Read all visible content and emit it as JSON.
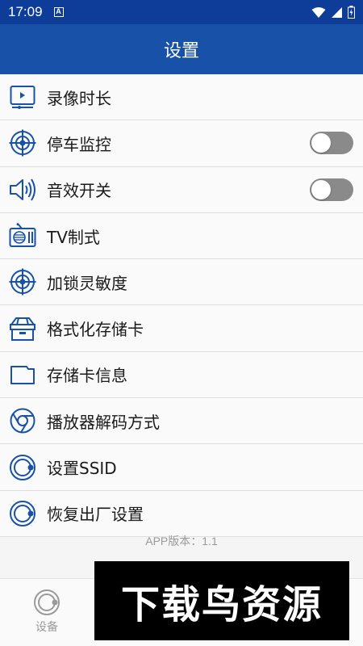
{
  "status_bar": {
    "time": "17:09",
    "a_badge": "A"
  },
  "app_bar": {
    "title": "设置"
  },
  "settings": [
    {
      "label": "录像时长",
      "icon": "video-duration-icon",
      "toggle": null
    },
    {
      "label": "停车监控",
      "icon": "target-icon",
      "toggle": false
    },
    {
      "label": "音效开关",
      "icon": "speaker-icon",
      "toggle": false
    },
    {
      "label": "TV制式",
      "icon": "tv-icon",
      "toggle": null
    },
    {
      "label": "加锁灵敏度",
      "icon": "target-icon",
      "toggle": null
    },
    {
      "label": "格式化存储卡",
      "icon": "box-icon",
      "toggle": null
    },
    {
      "label": "存储卡信息",
      "icon": "sd-card-icon",
      "toggle": null
    },
    {
      "label": "播放器解码方式",
      "icon": "chrome-icon",
      "toggle": null
    },
    {
      "label": "设置SSID",
      "icon": "ring-dot-icon",
      "toggle": null
    },
    {
      "label": "恢复出厂设置",
      "icon": "ring-dot-icon",
      "toggle": null
    }
  ],
  "version_text": "APP版本：1.1",
  "bottom_nav": {
    "device_label": "设备"
  },
  "watermark": {
    "text": "下载鸟资源"
  },
  "colors": {
    "status_bar": "#0d3d99",
    "app_bar": "#1752a8",
    "icon": "#1752a8",
    "toggle_off": "#8a8a8a"
  }
}
